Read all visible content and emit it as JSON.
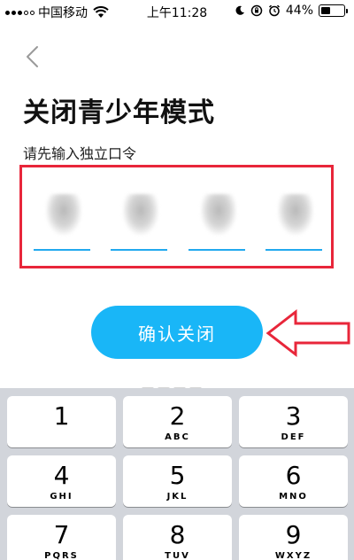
{
  "status_bar": {
    "carrier": "中国移动",
    "time": "上午11:28",
    "battery_percent_text": "44%",
    "battery_level": 0.44
  },
  "page": {
    "title": "关闭青少年模式",
    "subtitle": "请先输入独立口令"
  },
  "code_input": {
    "digit_count": 4
  },
  "confirm_button": {
    "label": "确认关闭",
    "color": "#19b6f7"
  },
  "annotation": {
    "box_color": "#e8263a",
    "arrow_color": "#e8263a"
  },
  "keypad": {
    "keys": [
      {
        "num": "1",
        "letters": ""
      },
      {
        "num": "2",
        "letters": "ABC"
      },
      {
        "num": "3",
        "letters": "DEF"
      },
      {
        "num": "4",
        "letters": "GHI"
      },
      {
        "num": "5",
        "letters": "JKL"
      },
      {
        "num": "6",
        "letters": "MNO"
      },
      {
        "num": "7",
        "letters": "PQRS"
      },
      {
        "num": "8",
        "letters": "TUV"
      },
      {
        "num": "9",
        "letters": "WXYZ"
      }
    ]
  }
}
